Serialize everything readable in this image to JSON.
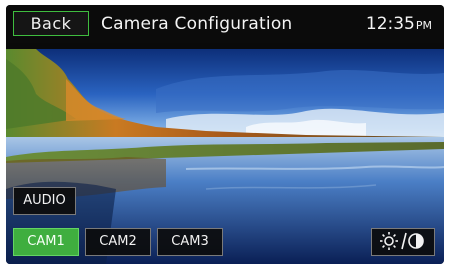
{
  "header": {
    "back_label": "Back",
    "title": "Camera Configuration",
    "time": "12:35",
    "ampm": "PM"
  },
  "preview": {
    "description_icon": "camera-preview-image"
  },
  "controls": {
    "audio_label": "AUDIO",
    "cameras": [
      {
        "label": "CAM1",
        "active": true
      },
      {
        "label": "CAM2",
        "active": false
      },
      {
        "label": "CAM3",
        "active": false
      }
    ],
    "brightness_contrast_icon": "brightness-contrast-icon"
  },
  "colors": {
    "accent": "#3fae3f",
    "background": "#0a0a0a",
    "text": "#f2f2f2"
  }
}
